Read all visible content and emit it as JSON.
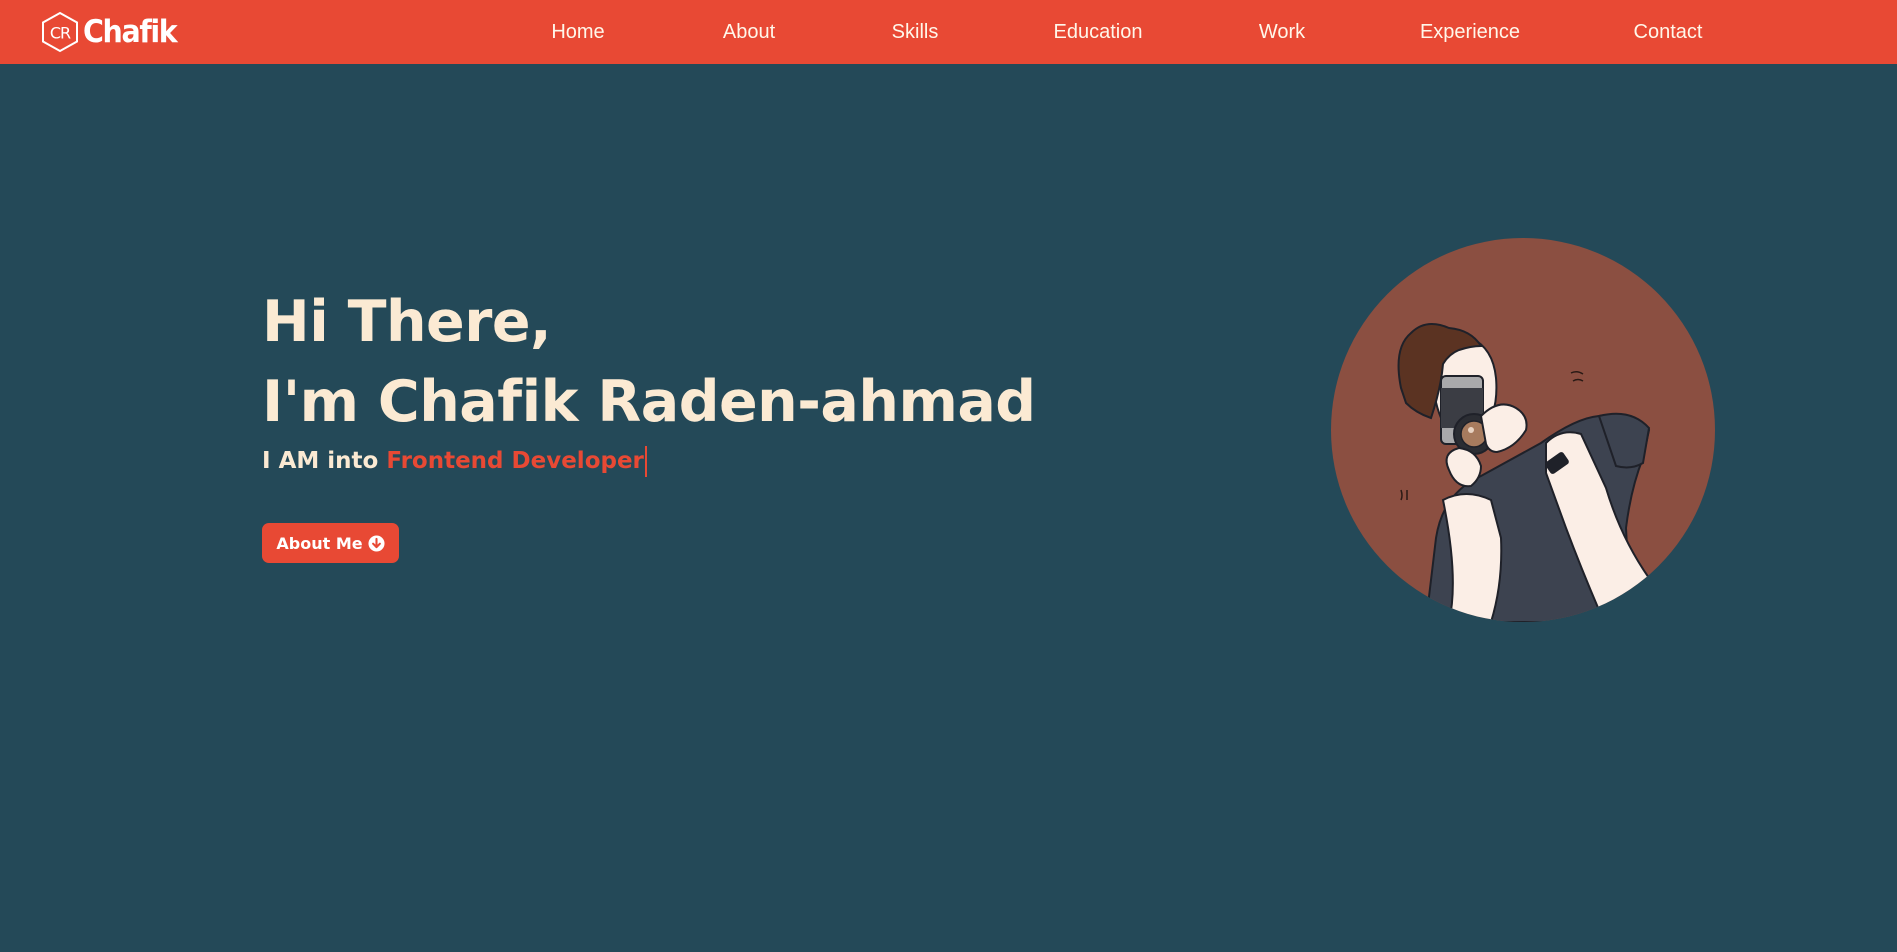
{
  "brand": {
    "logo_mark": "CR",
    "name": "Chafik"
  },
  "nav": {
    "items": [
      {
        "label": "Home"
      },
      {
        "label": "About"
      },
      {
        "label": "Skills"
      },
      {
        "label": "Education"
      },
      {
        "label": "Work"
      },
      {
        "label": "Experience"
      },
      {
        "label": "Contact"
      }
    ]
  },
  "hero": {
    "greeting": "Hi There,",
    "name_line": "I'm Chafik Raden-ahmad",
    "tagline_prefix": "I AM into",
    "tagline_typed": "Frontend Developer",
    "cta_label": "About Me",
    "cta_icon": "arrow-circle-down-icon",
    "illustration": "photographer-illustration"
  },
  "colors": {
    "nav_bg": "#e84934",
    "page_bg": "#244958",
    "accent": "#e84934",
    "hero_text": "#fbead3",
    "avatar_bg": "#8b4f41"
  }
}
